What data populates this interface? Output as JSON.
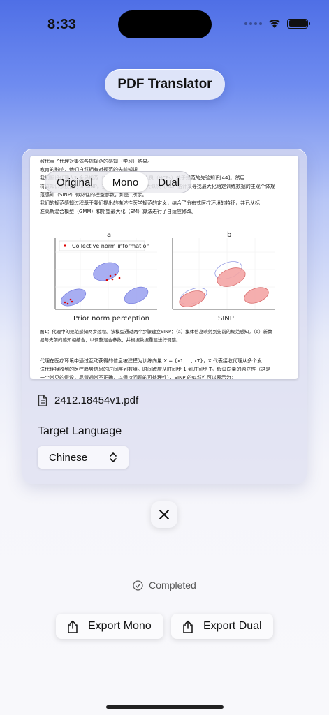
{
  "status_bar": {
    "time": "8:33"
  },
  "app": {
    "title": "PDF Translator"
  },
  "view_modes": [
    {
      "label": "Original",
      "active": false
    },
    {
      "label": "Mono",
      "active": true
    },
    {
      "label": "Dual",
      "active": false
    }
  ],
  "document": {
    "lines_top": [
      "赦代表了代理对集体各规规范的感知（学习）结果。",
      "",
      "                                          教育的影响，他们自然拥有对规范的先前知识",
      "    我们假设代理人对全局规范（SINP）数据集中的人员（HCPs）关于规范的先验知识[44]。然后",
      "将该知识参数化为 λ_SINP。接下来，我们使用最大似然（ML）估计来寻找最大化给定训练数据的主观个体规",
      "范感知（SINP）似然性的模型参数，如图1所示。"
    ],
    "lines_para2": [
      "    我们的规范感知过程基于我们提出的描述性医学规范的定义，结合了分布式医疗环境的特征，并已从标",
      "准高斯混合模型（GMM）和期望最大化（EM）算法进行了自适应修改。"
    ],
    "figure": {
      "panel_a_label": "a",
      "panel_b_label": "b",
      "legend_label": "Collective norm information",
      "xlabel_a": "Prior norm perception",
      "xlabel_b": "SINP"
    },
    "caption_lines": [
      "图1：代理中的规范感知两步过程。该模型通过两个步骤建立SINP：（a）集体信息映射到先前的规范感知。（b）新数",
      "据与先前的感知相结合，以调整混合参数，并根据数据重建进行调整。"
    ],
    "lines_bottom": [
      "    代理在医疗环境中通过互动获得的信息被建模为训练向量 X = {x1, ..., xT}，X 代表接收代理从多个发",
      "送代理接收到的医疗趋势信息的时间序列数组。时间跨度从时间步 1 到时间步 T。假设向量的独立性（这是",
      "一个常见的假设，尽管通常不正确，以保持问题的可处理性），SINP 的似然性可以表示为："
    ]
  },
  "file": {
    "name": "2412.18454v1.pdf"
  },
  "target_language": {
    "label": "Target Language",
    "value": "Chinese"
  },
  "status": {
    "text": "Completed"
  },
  "export": {
    "mono_label": "Export Mono",
    "dual_label": "Export Dual"
  }
}
